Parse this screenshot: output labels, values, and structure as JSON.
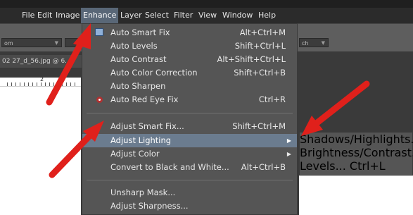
{
  "menubar": {
    "items": [
      "File",
      "Edit",
      "Image",
      "Enhance",
      "Layer",
      "Select",
      "Filter",
      "View",
      "Window",
      "Help"
    ],
    "active": "Enhance"
  },
  "options_bar": {
    "left_field": "om",
    "right_field": "ch"
  },
  "document": {
    "tab_label": "02 27_d_56.jpg @ 6..."
  },
  "ruler": {
    "visible_number": "2"
  },
  "enhance_menu": {
    "group1": [
      {
        "label": "Auto Smart Fix",
        "shortcut": "Alt+Ctrl+M",
        "icon": "smart-fix-icon"
      },
      {
        "label": "Auto Levels",
        "shortcut": "Shift+Ctrl+L"
      },
      {
        "label": "Auto Contrast",
        "shortcut": "Alt+Shift+Ctrl+L"
      },
      {
        "label": "Auto Color Correction",
        "shortcut": "Shift+Ctrl+B"
      },
      {
        "label": "Auto Sharpen",
        "shortcut": ""
      },
      {
        "label": "Auto Red Eye Fix",
        "shortcut": "Ctrl+R",
        "icon": "red-eye-icon"
      }
    ],
    "group2": [
      {
        "label": "Adjust Smart Fix...",
        "shortcut": "Shift+Ctrl+M"
      },
      {
        "label": "Adjust Lighting",
        "shortcut": "",
        "submenu": true,
        "highlighted": true
      },
      {
        "label": "Adjust Color",
        "shortcut": "",
        "submenu": true
      },
      {
        "label": "Convert to Black and White...",
        "shortcut": "Alt+Ctrl+B"
      }
    ],
    "group3": [
      {
        "label": "Unsharp Mask...",
        "shortcut": ""
      },
      {
        "label": "Adjust Sharpness...",
        "shortcut": ""
      }
    ]
  },
  "lighting_submenu": [
    {
      "label": "Shadows/Highlights...",
      "shortcut": ""
    },
    {
      "label": "Brightness/Contrast...",
      "shortcut": ""
    },
    {
      "label": "Levels...",
      "shortcut": "Ctrl+L"
    }
  ],
  "colors": {
    "menubar_bg": "#2b2b2b",
    "menu_bg": "#555555",
    "highlight": "#6b7c8f",
    "arrow_red": "#e0201b"
  }
}
